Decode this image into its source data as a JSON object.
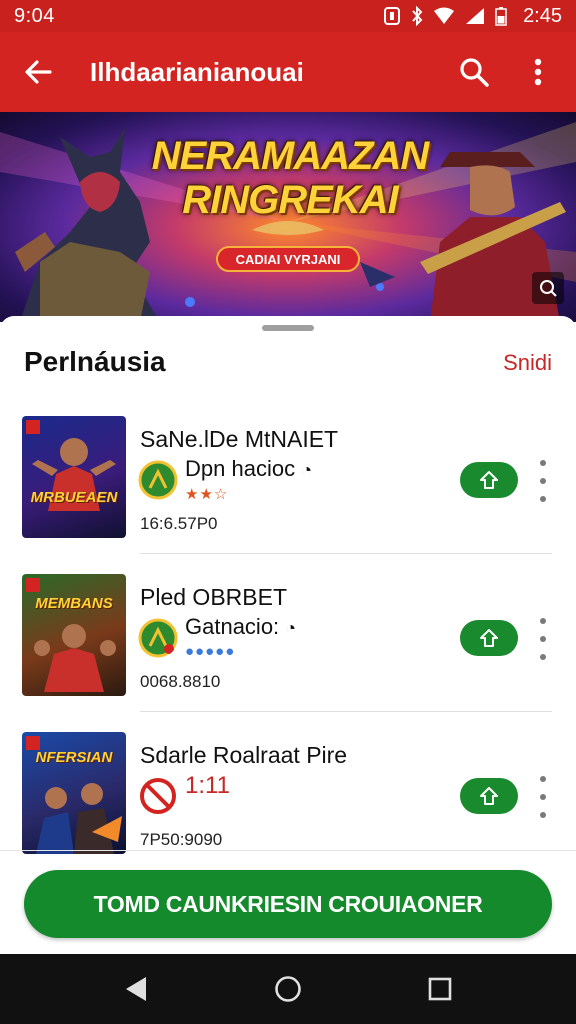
{
  "status_bar": {
    "time": "9:04",
    "clock": "2:45"
  },
  "app_bar": {
    "title": "Ilhdaarianianouai"
  },
  "banner": {
    "title_line1": "NERAMAAZAN",
    "title_line2": "RINGREKAI",
    "subtitle": "CADIAI VYRJANI"
  },
  "section": {
    "title": "Perlnáusia",
    "see_all": "Snidi"
  },
  "items": [
    {
      "name": "SaNe.lDe MtNAIET",
      "subtitle": "Dpn hacioc",
      "rating": "★★☆",
      "meta": "16:6.57P0",
      "thumb_title": "MRBUEAEN",
      "badge": "green"
    },
    {
      "name": "Pled OBRBET",
      "subtitle": "Gatnacio:",
      "rating": "●●●●●",
      "meta": "0068.8810",
      "thumb_title": "MEMBANS",
      "badge": "green"
    },
    {
      "name": "Sdarle Roalraat Pire",
      "subtitle": "1:11",
      "rating": "",
      "meta": "7P50:9090",
      "thumb_title": "NFERSIAN",
      "badge": "red"
    }
  ],
  "cta": {
    "label": "TOMD CAUNKRIESIN CROUIAONER"
  },
  "colors": {
    "primary": "#d32421",
    "accent_green": "#158a2c",
    "link": "#c62828"
  },
  "icons": {
    "back": "arrow-left-icon",
    "search": "search-icon",
    "menu": "more-vert-icon",
    "install": "install-icon"
  }
}
